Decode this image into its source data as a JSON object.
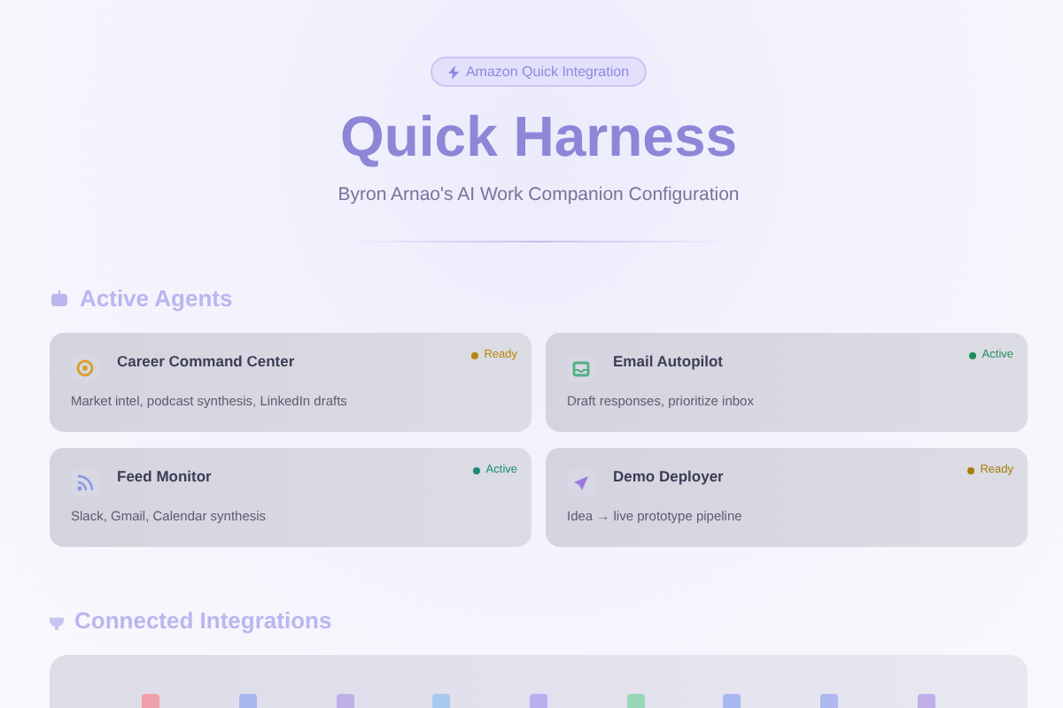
{
  "header": {
    "badge": "Amazon Quick Integration",
    "title": "Quick Harness",
    "subtitle": "Byron Arnao's AI Work Companion Configuration"
  },
  "agents_section": {
    "title": "Active Agents",
    "agents": [
      {
        "name": "Career Command Center",
        "description": "Market intel, podcast synthesis, LinkedIn drafts",
        "status": "Ready",
        "color": "#b8860b"
      },
      {
        "name": "Email Autopilot",
        "description": "Draft responses, prioritize inbox",
        "status": "Active",
        "color": "#1f8f5a"
      },
      {
        "name": "Feed Monitor",
        "description": "Slack, Gmail, Calendar synthesis",
        "status": "Active",
        "color": "#1a8a78"
      },
      {
        "name": "Demo Deployer",
        "description": "Idea → live prototype pipeline",
        "status": "Ready",
        "color": "#a87c0a"
      }
    ]
  },
  "integrations_section": {
    "title": "Connected Integrations",
    "integrations": [
      {
        "color": "#f0a0a8"
      },
      {
        "color": "#a8b8f0"
      },
      {
        "color": "#c0b0e8"
      },
      {
        "color": "#a8c8f0"
      },
      {
        "color": "#b8b0f0"
      },
      {
        "color": "#98d8b8"
      },
      {
        "color": "#a8b8f0"
      },
      {
        "color": "#b0b8f0"
      },
      {
        "color": "#c0b0e8"
      }
    ]
  }
}
